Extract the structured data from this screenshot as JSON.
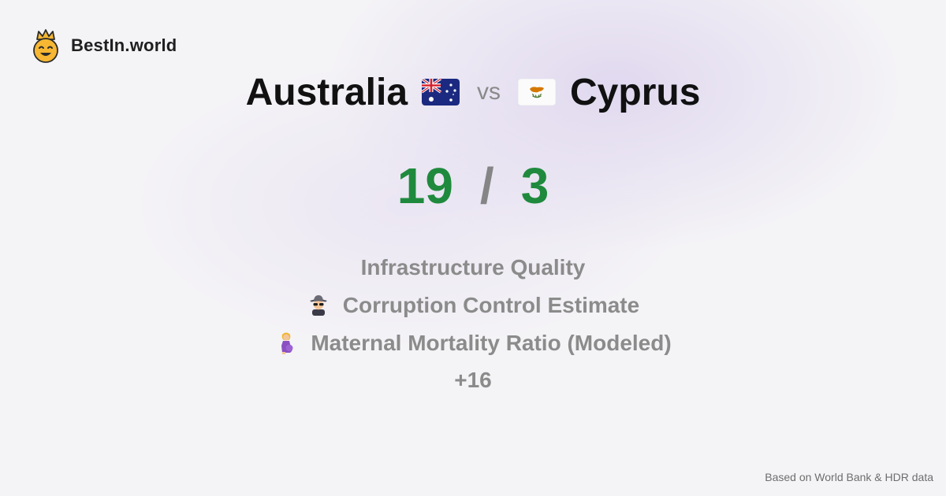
{
  "brand": {
    "name": "BestIn.world",
    "icon": "crowned-smiley-icon"
  },
  "comparison": {
    "left": {
      "name": "Australia",
      "flag_icon": "australia-flag-icon",
      "score": "19"
    },
    "separator": "vs",
    "right": {
      "name": "Cyprus",
      "flag_icon": "cyprus-flag-icon",
      "score": "3"
    },
    "score_separator": "/"
  },
  "metrics": [
    {
      "label": "Infrastructure Quality",
      "icon": ""
    },
    {
      "label": "Corruption Control Estimate",
      "icon": "detective-icon"
    },
    {
      "label": "Maternal Mortality Ratio (Modeled)",
      "icon": "pregnant-woman-icon"
    }
  ],
  "more_count": "+16",
  "footer": "Based on World Bank & HDR data",
  "colors": {
    "score": "#1f8a3d",
    "muted": "#8b8b8b",
    "accent": "#f5b731"
  }
}
